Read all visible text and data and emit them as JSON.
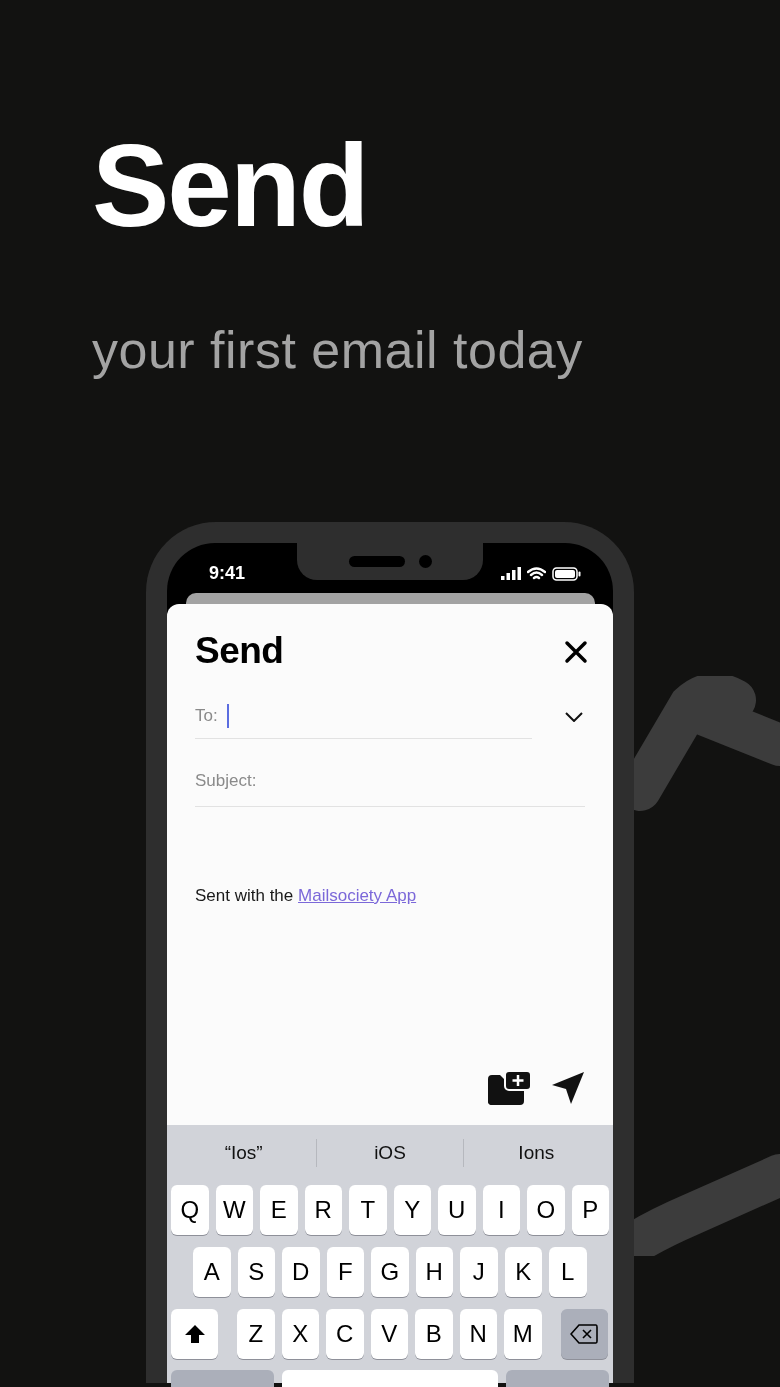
{
  "headline": "Send",
  "subheadline": "your first email today",
  "phone": {
    "status_bar": {
      "time": "9:41"
    },
    "compose": {
      "title": "Send",
      "to_field": {
        "label": "To:",
        "focused": true
      },
      "subject_field": {
        "label": "Subject:"
      },
      "signature": {
        "text": "Sent with the ",
        "link": "Mailsociety App"
      }
    },
    "keyboard": {
      "suggestions": [
        {
          "text": "“Ios”"
        },
        {
          "text": "iOS"
        },
        {
          "text": "Ions"
        }
      ],
      "rows": [
        [
          {
            "kind": "letter",
            "label": "Q"
          },
          {
            "kind": "letter",
            "label": "W"
          },
          {
            "kind": "letter",
            "label": "E"
          },
          {
            "kind": "letter",
            "label": "R"
          },
          {
            "kind": "letter",
            "label": "T"
          },
          {
            "kind": "letter",
            "label": "Y"
          },
          {
            "kind": "letter",
            "label": "U"
          },
          {
            "kind": "letter",
            "label": "I"
          },
          {
            "kind": "letter",
            "label": "O"
          },
          {
            "kind": "letter",
            "label": "P"
          }
        ],
        [
          {
            "kind": "letter",
            "label": "A"
          },
          {
            "kind": "letter",
            "label": "S"
          },
          {
            "kind": "letter",
            "label": "D"
          },
          {
            "kind": "letter",
            "label": "F"
          },
          {
            "kind": "letter",
            "label": "G"
          },
          {
            "kind": "letter",
            "label": "H"
          },
          {
            "kind": "letter",
            "label": "J"
          },
          {
            "kind": "letter",
            "label": "K"
          },
          {
            "kind": "letter",
            "label": "L"
          }
        ],
        [
          {
            "kind": "shift"
          },
          {
            "kind": "letter",
            "label": "Z"
          },
          {
            "kind": "letter",
            "label": "X"
          },
          {
            "kind": "letter",
            "label": "C"
          },
          {
            "kind": "letter",
            "label": "V"
          },
          {
            "kind": "letter",
            "label": "B"
          },
          {
            "kind": "letter",
            "label": "N"
          },
          {
            "kind": "letter",
            "label": "M"
          },
          {
            "kind": "delete"
          }
        ]
      ]
    }
  }
}
